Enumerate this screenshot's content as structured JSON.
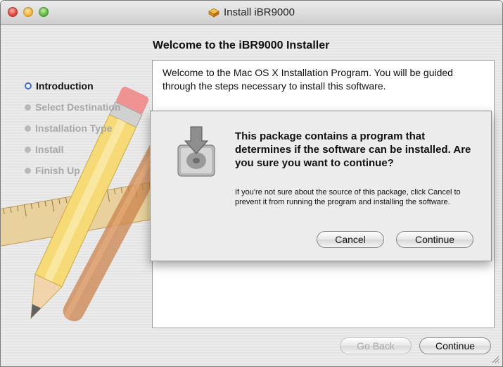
{
  "window": {
    "title": "Install iBR9000",
    "header": "Welcome to the iBR9000 Installer"
  },
  "steps": [
    {
      "label": "Introduction",
      "active": true
    },
    {
      "label": "Select Destination",
      "active": false
    },
    {
      "label": "Installation Type",
      "active": false
    },
    {
      "label": "Install",
      "active": false
    },
    {
      "label": "Finish Up",
      "active": false
    }
  ],
  "content": {
    "text": "Welcome to the Mac OS X Installation Program. You will be guided through the steps necessary to install this software."
  },
  "dialog": {
    "title": "This package contains a program that determines if the software can be installed.  Are you sure you want to continue?",
    "message": "If you're not sure about the source of this package, click Cancel to prevent it from running the program and installing the software.",
    "cancel_label": "Cancel",
    "continue_label": "Continue"
  },
  "footer": {
    "go_back_label": "Go Back",
    "continue_label": "Continue"
  },
  "colors": {
    "accent": "#3b6fc9"
  }
}
